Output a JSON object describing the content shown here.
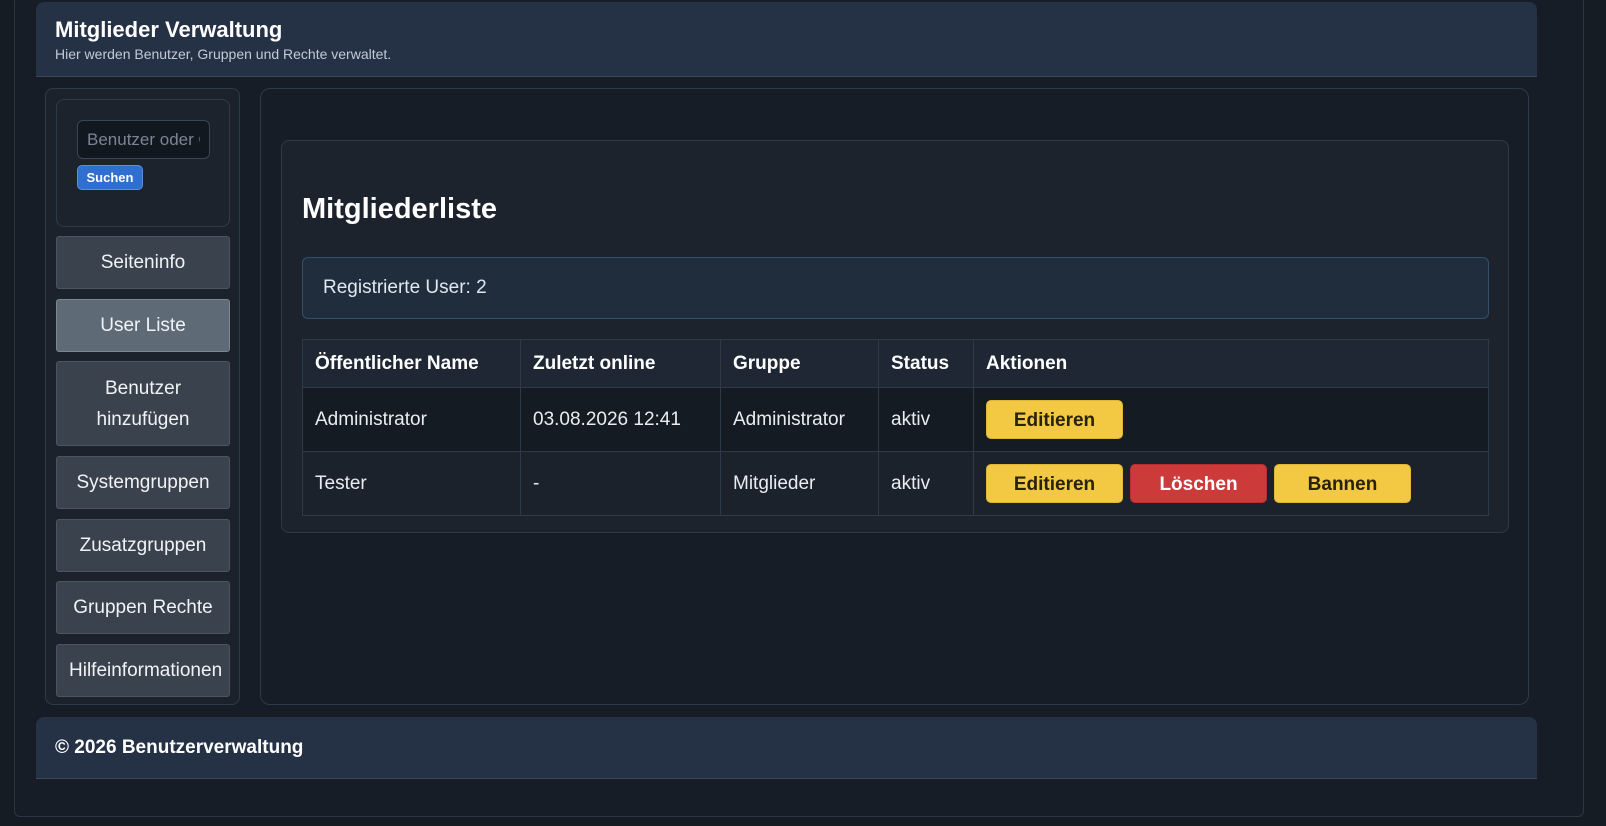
{
  "header": {
    "title": "Mitglieder Verwaltung",
    "subtitle": "Hier werden Benutzer, Gruppen und Rechte verwaltet."
  },
  "sidebar": {
    "search": {
      "placeholder": "Benutzer oder Gruppe",
      "button_label": "Suchen"
    },
    "items": [
      {
        "label": "Seiteninfo",
        "active": false
      },
      {
        "label": "User Liste",
        "active": true
      },
      {
        "label": "Benutzer hinzufügen",
        "active": false
      },
      {
        "label": "Systemgruppen",
        "active": false
      },
      {
        "label": "Zusatzgruppen",
        "active": false
      },
      {
        "label": "Gruppen Rechte",
        "active": false
      },
      {
        "label": "Hilfeinformationen",
        "active": false
      }
    ]
  },
  "main": {
    "title": "Mitgliederliste",
    "info": "Registrierte User: 2",
    "table": {
      "headers": [
        "Öffentlicher Name",
        "Zuletzt online",
        "Gruppe",
        "Status",
        "Aktionen"
      ],
      "rows": [
        {
          "name": "Administrator",
          "last_online": "03.08.2026 12:41",
          "group": "Administrator",
          "status": "aktiv",
          "actions": [
            "Editieren"
          ]
        },
        {
          "name": "Tester",
          "last_online": "-",
          "group": "Mitglieder",
          "status": "aktiv",
          "actions": [
            "Editieren",
            "Löschen",
            "Bannen"
          ]
        }
      ]
    }
  },
  "footer": {
    "text": "© 2026 Benutzerverwaltung"
  },
  "colors": {
    "accent_blue": "#2f6fd0",
    "button_yellow": "#f3c843",
    "button_red": "#cc3a3a",
    "header_bg": "#253144"
  }
}
